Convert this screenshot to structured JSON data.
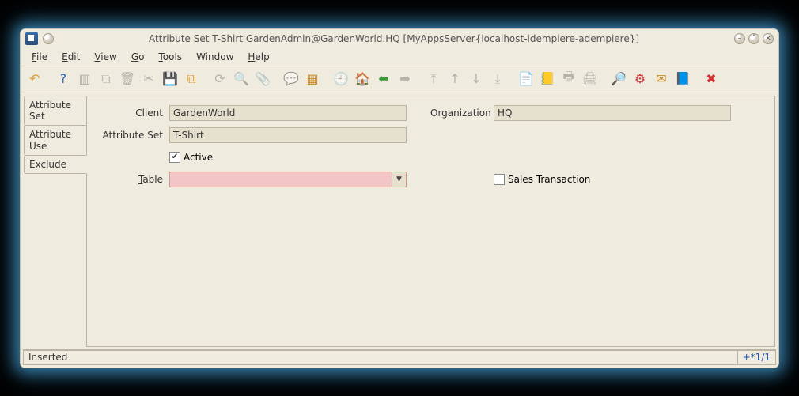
{
  "window": {
    "title": "Attribute Set  T-Shirt  GardenAdmin@GardenWorld.HQ [MyAppsServer{localhost-idempiere-adempiere}]"
  },
  "menu": {
    "file": "File",
    "edit": "Edit",
    "view": "View",
    "go": "Go",
    "tools": "Tools",
    "window": "Window",
    "help": "Help"
  },
  "tabs": {
    "t0a": "Attribute",
    "t0b": "Set",
    "t1a": "Attribute",
    "t1b": "Use",
    "t2": "Exclude"
  },
  "form": {
    "client_label": "Client",
    "client_value": "GardenWorld",
    "org_label": "Organization",
    "org_value": "HQ",
    "attrset_label": "Attribute Set",
    "attrset_value": "T-Shirt",
    "active_label": "Active",
    "table_label": "Table",
    "table_value": "",
    "sales_label": "Sales Transaction"
  },
  "status": {
    "left": "Inserted",
    "right": "+*1/1"
  },
  "toolbar_icons": {
    "undo": "↶",
    "help": "?",
    "new": "▥",
    "copy": "⧉",
    "del": "🗑",
    "delsel": "✂",
    "save": "💾",
    "savenew": "⧉",
    "refresh": "⟳",
    "find": "🔍",
    "attach": "📎",
    "chat": "💬",
    "grid": "▦",
    "history": "🕘",
    "home": "🏠",
    "back": "⬅",
    "fwd": "➡",
    "first": "⤒",
    "prev": "↑",
    "next": "↓",
    "last": "⤓",
    "report": "📄",
    "archive": "📒",
    "print": "🖨",
    "printview": "🖶",
    "zoom": "🔎",
    "wf": "⚙",
    "req": "✉",
    "prod": "📘",
    "close": "✖"
  }
}
